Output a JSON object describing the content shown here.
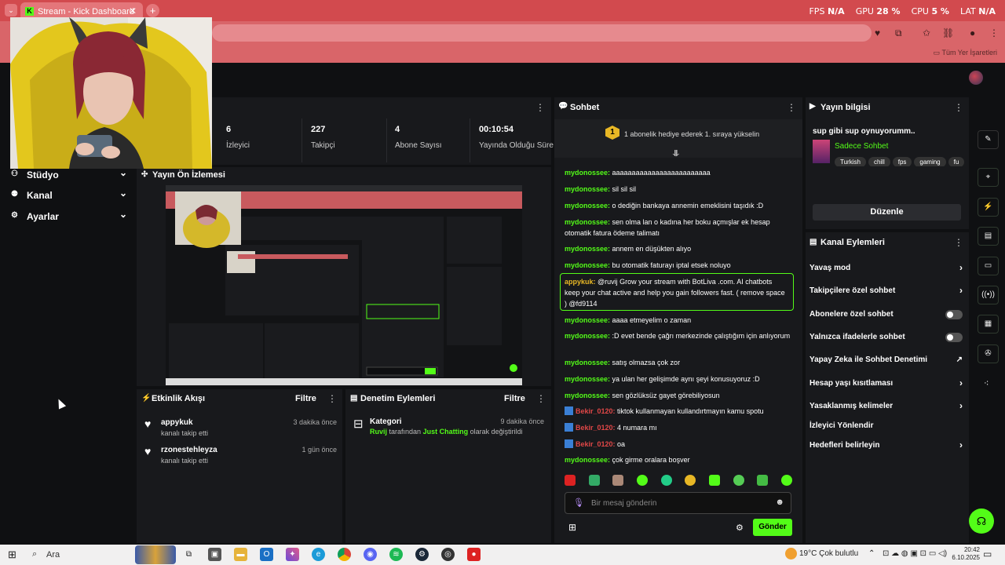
{
  "browser": {
    "tab_title": "Stream - Kick Dashboard",
    "favicon": "K",
    "bookmarks_label": "Tüm Yer İşaretleri"
  },
  "perf": {
    "fps_label": "FPS",
    "fps_value": "N/A",
    "gpu_label": "GPU",
    "gpu_value": "28 %",
    "cpu_label": "CPU",
    "cpu_value": "5 %",
    "lat_label": "LAT",
    "lat_value": "N/A"
  },
  "sidebar": {
    "items": [
      {
        "label": "Stüdyo",
        "icon": "studio-icon"
      },
      {
        "label": "Kanal",
        "icon": "channel-icon"
      },
      {
        "label": "Ayarlar",
        "icon": "gear-icon"
      }
    ]
  },
  "stats_panel": {
    "title_fragment": "i",
    "stats": [
      {
        "value": "6",
        "label": "İzleyici"
      },
      {
        "value": "227",
        "label": "Takipçi"
      },
      {
        "value": "4",
        "label": "Abone Sayısı"
      },
      {
        "value": "00:10:54",
        "label": "Yayında Olduğu Süre"
      }
    ]
  },
  "preview": {
    "title": "Yayın Ön İzlemesi"
  },
  "activity": {
    "title": "Etkinlik Akışı",
    "filter": "Filtre",
    "events": [
      {
        "name": "appykuk",
        "sub": "kanalı takip etti",
        "time": "3 dakika önce"
      },
      {
        "name": "rzonestehleyza",
        "sub": "kanalı takip etti",
        "time": "1 gün önce"
      }
    ]
  },
  "modlog": {
    "title": "Denetim Eylemleri",
    "filter": "Filtre",
    "entry": {
      "title": "Kategori",
      "time": "9 dakika önce",
      "actor": "Ruvij",
      "mid": " tarafından ",
      "category": "Just Chatting",
      "tail": " olarak değiştirildi"
    }
  },
  "chat": {
    "title": "Sohbet",
    "rank": "1",
    "promo": "1 abonelik hediye ederek 1. sıraya yükselin",
    "messages": [
      {
        "user": "mydonossee:",
        "text": " aaaaaaaaaaaaaaaaaaaaaaaaa"
      },
      {
        "user": "mydonossee:",
        "text": " sil sil sil"
      },
      {
        "user": "mydonossee:",
        "text": " o dediğin bankaya annemin emeklisini taşıdık :D"
      },
      {
        "user": "mydonossee:",
        "text": " sen olma lan o kadına her boku açmışlar ek hesap otomatik fatura ödeme talimatı"
      },
      {
        "user": "mydonossee:",
        "text": " annem en düşükten alıyo"
      },
      {
        "user": "mydonossee:",
        "text": " bu otomatik faturayı iptal etsek noluyo"
      },
      {
        "user": "appykuk:",
        "text": " @ruvij Grow your stream with BotLiva .com. AI chatbots keep your chat active and help you gain followers fast. ( remove space ) @fd9114"
      },
      {
        "user": "mydonossee:",
        "text": " aaaa etmeyelim o zaman"
      },
      {
        "user": "mydonossee:",
        "text": " :D evet bende çağrı merkezinde çalıştığım için anlıyorum"
      },
      {
        "user": "mydonossee:",
        "text": " satış olmazsa çok zor"
      },
      {
        "user": "mydonossee:",
        "text": " ya ulan her gelişimde aynı şeyi konusuyoruz :D"
      },
      {
        "user": "mydonossee:",
        "text": " sen gözlüksüz gayet görebiliyosun"
      },
      {
        "user": "Bekir_0120:",
        "text": " tiktok kullanmayan kullandırtmayın kamu spotu"
      },
      {
        "user": "Bekir_0120:",
        "text": " 4 numara mı"
      },
      {
        "user": "Bekir_0120:",
        "text": " oa"
      },
      {
        "user": "mydonossee:",
        "text": " çok girme oralara boşver"
      }
    ],
    "input_placeholder": "Bir mesaj gönderin",
    "send_label": "Gönder"
  },
  "stream_info": {
    "title": "Yayın bilgisi",
    "stream_title": "sup gibi sup oynuyorumm..",
    "category": "Sadece Sohbet",
    "tags": [
      "Turkish",
      "chill",
      "fps",
      "gaming",
      "fu"
    ],
    "edit_label": "Düzenle"
  },
  "channel_actions": {
    "title": "Kanal Eylemleri",
    "items": [
      {
        "label": "Yavaş mod"
      },
      {
        "label": "Takipçilere özel sohbet"
      },
      {
        "label": "Abonelere özel sohbet"
      },
      {
        "label": "Yalnızca ifadelerle sohbet"
      },
      {
        "label": "Yapay Zeka ile Sohbet Denetimi"
      },
      {
        "label": "Hesap yaşı kısıtlaması"
      },
      {
        "label": "Yasaklanmış kelimeler"
      },
      {
        "label": "İzleyici Yönlendir"
      },
      {
        "label": "Hedefleri belirleyin"
      }
    ]
  },
  "taskbar": {
    "search_label": "Ara",
    "weather": "19°C  Çok bulutlu",
    "time": "20:42",
    "date": "6.10.2025"
  },
  "colors": {
    "accent": "#53fc18",
    "browser_frame": "#d24a4e",
    "panel": "#18191c"
  }
}
